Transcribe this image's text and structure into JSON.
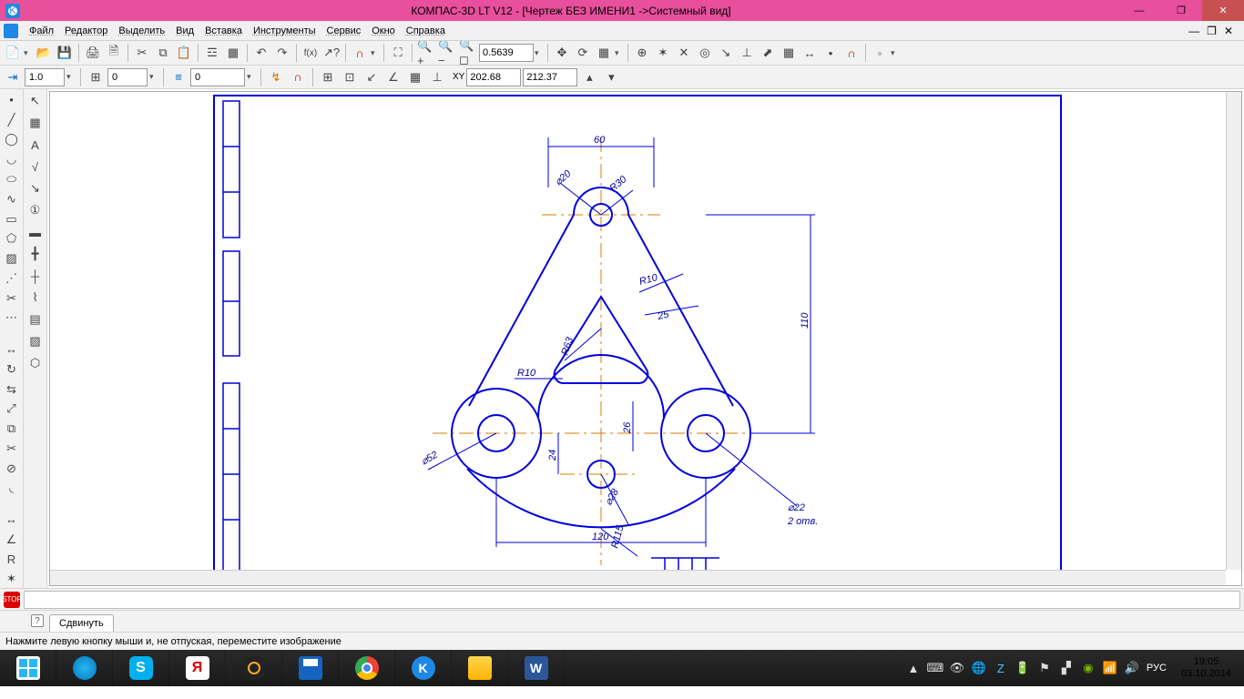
{
  "window": {
    "title": "КОМПАС-3D LT V12 - [Чертеж БЕЗ ИМЕНИ1 ->Системный вид]"
  },
  "menu": {
    "items": [
      "Файл",
      "Редактор",
      "Выделить",
      "Вид",
      "Вставка",
      "Инструменты",
      "Сервис",
      "Окно",
      "Справка"
    ]
  },
  "toolbar_main": {
    "zoom": "0.5639"
  },
  "propbar": {
    "step": "1.0",
    "angle": "0",
    "layer": "0",
    "x": "202.68",
    "y": "212.37"
  },
  "tabs": {
    "current": "Сдвинуть"
  },
  "status": {
    "hint": "Нажмите левую кнопку мыши и, не отпуская, переместите изображение"
  },
  "taskbar": {
    "lang": "РУС",
    "time": "19:05",
    "date": "03.10.2014"
  },
  "drawing": {
    "dim_60": "60",
    "dim_phi20": "⌀20",
    "dim_R30": "R30",
    "dim_R10a": "R10",
    "dim_25": "25",
    "dim_110": "110",
    "dim_R10b": "R10",
    "dim_R63": "R63",
    "dim_phi52": "⌀52",
    "dim_24": "24",
    "dim_26": "26",
    "dim_phi28": "⌀28",
    "dim_120": "120",
    "dim_R115": "R115",
    "dim_phi22": "⌀22",
    "dim_2otv": "2 отв."
  }
}
